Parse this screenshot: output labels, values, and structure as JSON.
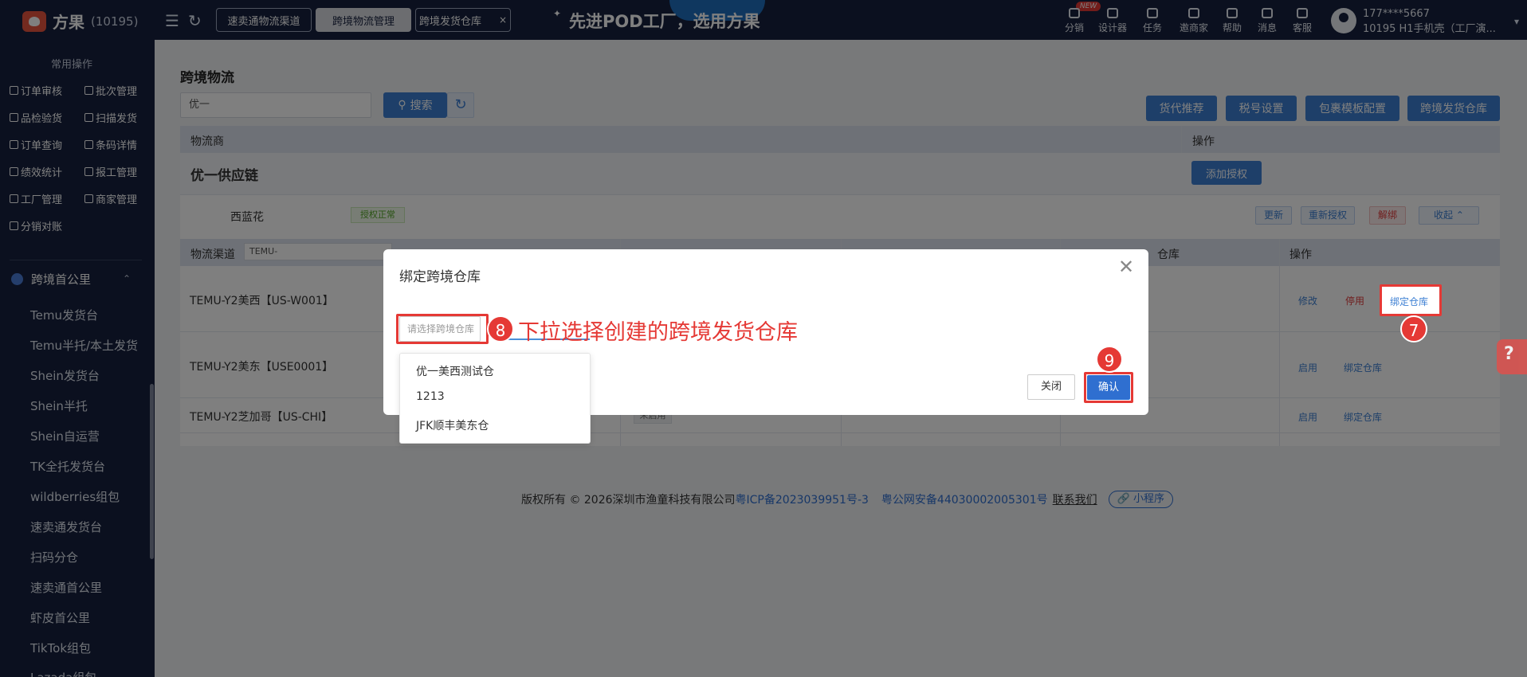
{
  "topbar": {
    "brand": "方果",
    "brand_id": "(10195)",
    "tabs": [
      "速卖通物流渠道",
      "跨境物流管理",
      "跨境发货仓库"
    ],
    "tab_close": "×",
    "slogan": "先进POD工厂，选用方果",
    "new_badge": "NEW",
    "tools": [
      "分销",
      "设计器",
      "任务",
      "邀商家",
      "帮助",
      "消息",
      "客服"
    ],
    "user_phone": "177****5667",
    "user_org": "10195 H1手机壳（工厂演...",
    "icons": [
      "menu-icon",
      "refresh-icon",
      "user-avatar-icon"
    ]
  },
  "sidebar": {
    "group_title": "常用操作",
    "quick_actions": [
      "订单审核",
      "批次管理",
      "品检验货",
      "扫描发货",
      "订单查询",
      "条码详情",
      "绩效统计",
      "报工管理",
      "工厂管理",
      "商家管理",
      "分销对账"
    ],
    "section": "跨境首公里",
    "items": [
      "Temu发货台",
      "Temu半托/本土发货",
      "Shein发货台",
      "Shein半托",
      "Shein自运营",
      "TK全托发货台",
      "wildberries组包",
      "速卖通发货台",
      "扫码分仓",
      "速卖通首公里",
      "虾皮首公里",
      "TikTok组包",
      "Lazada组包"
    ]
  },
  "main": {
    "title": "跨境物流",
    "search_value": "优一",
    "search_button": "搜索",
    "actions": [
      "货代推荐",
      "税号设置",
      "包裹模板配置",
      "跨境发货仓库"
    ],
    "table1_headers": [
      "物流商",
      "操作"
    ],
    "provider": "优一供应链",
    "add_auth": "添加授权",
    "account": "西蓝花",
    "auth_status": "授权正常",
    "account_actions": [
      "更新",
      "重新授权",
      "解绑",
      "收起"
    ],
    "table2_headers": [
      "物流渠道",
      "仓库",
      "操作"
    ],
    "channel_filter": "TEMU-",
    "rows": [
      {
        "name": "TEMU-Y2美西【US-W001】",
        "actions": [
          "修改",
          "停用",
          "绑定仓库"
        ]
      },
      {
        "name": "TEMU-Y2美东【USE0001】",
        "actions": [
          "启用",
          "绑定仓库"
        ]
      },
      {
        "name": "TEMU-Y2芝加哥【US-CHI】",
        "status": "未启用",
        "actions": [
          "启用",
          "绑定仓库"
        ]
      }
    ]
  },
  "footer": {
    "copyright": "版权所有 © 2026深圳市渔童科技有限公司",
    "icp": "粤ICP备2023039951号-3",
    "police": "粤公网安备44030002005301号",
    "contact": "联系我们",
    "mini_program": "小程序"
  },
  "modal": {
    "title": "绑定跨境仓库",
    "select_placeholder": "请选择跨境仓库",
    "options": [
      "优一美西测试仓",
      "1213",
      "JFK顺丰美东仓"
    ],
    "close_button": "关闭",
    "confirm_button": "确认"
  },
  "annotations": {
    "step7": "7",
    "step8": "8",
    "step8_text": "下拉选择创建的跨境发货仓库",
    "step9": "9",
    "highlight_color": "#e53935"
  },
  "colors": {
    "nav_bg": "#17213e",
    "primary": "#3c7fd3",
    "danger": "#e53935"
  }
}
